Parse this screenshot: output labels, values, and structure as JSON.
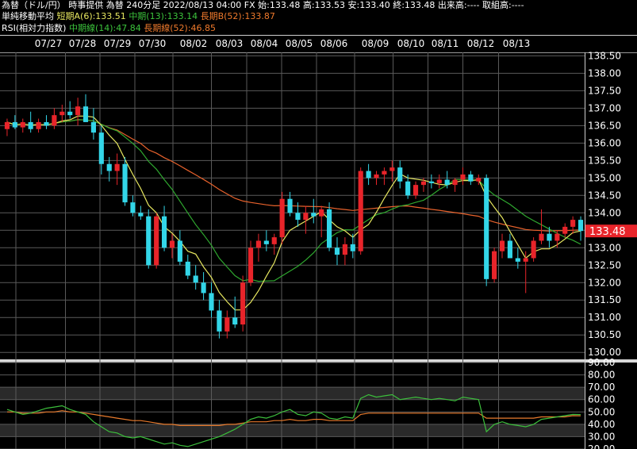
{
  "header": {
    "line1": "為替（ドル/円） 時事提供 為替 240分足 2022/08/13 04:00 FX 始:133.48 高:133.53 安:133.40 終:133.48 出来高:---- 取組高:----",
    "line2_prefix": "単純移動平均 ",
    "ma_short": "短期A(6):133.51",
    "ma_mid": "中期(13):133.14",
    "ma_long": "長期B(52):133.87",
    "line3_prefix": "RSI(相対力指数) ",
    "rsi_mid": "中期線(14):47.84",
    "rsi_long": "長期線(52):46.85"
  },
  "colors": {
    "up": "#e8242a",
    "down": "#33d6e8",
    "ma_short": "#e8e860",
    "ma_mid": "#2fa82f",
    "ma_long": "#e8622c",
    "rsi_mid": "#3cbf3c",
    "rsi_long": "#e87a2c",
    "price_tag": "#e8242a"
  },
  "chart_data": [
    {
      "type": "candlestick",
      "x_labels": [
        "07/27",
        "07/28",
        "07/29",
        "07/30",
        "08/02",
        "08/03",
        "08/04",
        "08/05",
        "08/06",
        "08/09",
        "08/10",
        "08/11",
        "08/12",
        "08/13"
      ],
      "y_ticks": [
        "138.50",
        "138.00",
        "137.50",
        "137.00",
        "136.50",
        "136.00",
        "135.50",
        "135.00",
        "134.50",
        "134.00",
        "133.50",
        "133.00",
        "132.50",
        "132.00",
        "131.50",
        "131.00",
        "130.50",
        "130.00"
      ],
      "ylim": [
        129.8,
        138.6
      ],
      "last_price": "133.48",
      "candles": [
        [
          136.4,
          136.7,
          136.2,
          136.6
        ],
        [
          136.6,
          136.8,
          136.4,
          136.45
        ],
        [
          136.45,
          136.7,
          136.3,
          136.6
        ],
        [
          136.6,
          136.9,
          136.3,
          136.4
        ],
        [
          136.4,
          136.7,
          136.3,
          136.6
        ],
        [
          136.6,
          136.8,
          136.4,
          136.5
        ],
        [
          136.5,
          137.0,
          136.4,
          136.8
        ],
        [
          136.8,
          137.1,
          136.6,
          136.9
        ],
        [
          136.9,
          137.2,
          136.7,
          136.8
        ],
        [
          136.8,
          137.3,
          136.5,
          137.05
        ],
        [
          137.05,
          137.4,
          136.7,
          136.6
        ],
        [
          136.6,
          137.0,
          136.1,
          136.3
        ],
        [
          136.3,
          136.5,
          135.1,
          135.4
        ],
        [
          135.4,
          135.6,
          134.9,
          135.2
        ],
        [
          135.2,
          135.7,
          134.8,
          135.4
        ],
        [
          135.4,
          135.6,
          134.2,
          134.3
        ],
        [
          134.3,
          134.5,
          133.9,
          134.0
        ],
        [
          134.0,
          134.2,
          133.8,
          133.9
        ],
        [
          133.9,
          134.1,
          132.4,
          132.5
        ],
        [
          132.5,
          134.0,
          132.4,
          133.9
        ],
        [
          133.9,
          134.2,
          132.9,
          133.0
        ],
        [
          133.0,
          133.4,
          132.7,
          133.2
        ],
        [
          133.2,
          133.5,
          132.5,
          132.6
        ],
        [
          132.6,
          132.8,
          132.1,
          132.2
        ],
        [
          132.2,
          132.5,
          131.8,
          132.0
        ],
        [
          132.0,
          132.3,
          131.5,
          131.7
        ],
        [
          131.7,
          132.0,
          131.0,
          131.2
        ],
        [
          131.2,
          131.5,
          130.4,
          130.6
        ],
        [
          130.6,
          131.2,
          130.4,
          131.0
        ],
        [
          131.0,
          131.6,
          130.7,
          130.8
        ],
        [
          130.8,
          132.2,
          130.6,
          132.0
        ],
        [
          132.0,
          133.2,
          131.9,
          133.0
        ],
        [
          133.0,
          133.4,
          132.6,
          133.2
        ],
        [
          133.2,
          133.5,
          132.9,
          133.1
        ],
        [
          133.1,
          133.4,
          132.8,
          133.3
        ],
        [
          133.3,
          134.6,
          133.1,
          134.4
        ],
        [
          134.4,
          134.6,
          133.9,
          134.0
        ],
        [
          134.0,
          134.3,
          133.6,
          133.8
        ],
        [
          133.8,
          134.2,
          133.4,
          134.0
        ],
        [
          134.0,
          134.4,
          133.7,
          133.9
        ],
        [
          133.9,
          134.2,
          133.3,
          134.1
        ],
        [
          134.1,
          134.3,
          132.9,
          133.0
        ],
        [
          133.0,
          133.3,
          132.5,
          132.8
        ],
        [
          132.8,
          133.3,
          132.5,
          133.1
        ],
        [
          133.1,
          133.4,
          132.7,
          132.9
        ],
        [
          132.9,
          135.3,
          132.8,
          135.2
        ],
        [
          135.2,
          135.4,
          134.8,
          135.0
        ],
        [
          135.0,
          135.2,
          134.8,
          135.1
        ],
        [
          135.1,
          135.3,
          134.8,
          135.2
        ],
        [
          135.2,
          135.5,
          134.9,
          135.3
        ],
        [
          135.3,
          135.5,
          134.7,
          134.9
        ],
        [
          134.9,
          135.1,
          134.4,
          134.5
        ],
        [
          134.5,
          134.9,
          134.4,
          134.8
        ],
        [
          134.8,
          135.0,
          134.6,
          134.9
        ],
        [
          134.9,
          135.1,
          134.7,
          134.85
        ],
        [
          134.85,
          135.1,
          134.7,
          134.95
        ],
        [
          134.95,
          135.2,
          134.7,
          134.8
        ],
        [
          134.8,
          135.0,
          134.6,
          134.95
        ],
        [
          134.95,
          135.3,
          134.8,
          135.1
        ],
        [
          135.1,
          135.2,
          134.8,
          134.9
        ],
        [
          134.9,
          135.1,
          134.8,
          135.0
        ],
        [
          135.0,
          135.1,
          131.9,
          132.1
        ],
        [
          132.1,
          133.0,
          132.0,
          132.9
        ],
        [
          132.9,
          133.4,
          132.7,
          133.2
        ],
        [
          133.2,
          133.4,
          132.8,
          132.7
        ],
        [
          132.7,
          133.0,
          132.4,
          132.6
        ],
        [
          132.6,
          132.9,
          131.7,
          132.7
        ],
        [
          132.7,
          133.3,
          132.6,
          133.2
        ],
        [
          133.2,
          134.1,
          133.1,
          133.4
        ],
        [
          133.4,
          133.6,
          133.0,
          133.2
        ],
        [
          133.2,
          133.5,
          133.0,
          133.4
        ],
        [
          133.4,
          133.7,
          133.3,
          133.6
        ],
        [
          133.6,
          133.9,
          133.4,
          133.8
        ],
        [
          133.8,
          133.9,
          133.2,
          133.48
        ]
      ]
    },
    {
      "type": "line",
      "title": "RSI(相対力指数)",
      "y_ticks": [
        "90.00",
        "80.00",
        "70.00",
        "60.00",
        "50.00",
        "40.00",
        "30.00",
        "20.00"
      ],
      "ylim": [
        20,
        90
      ],
      "series": [
        {
          "name": "中期線(14)",
          "values": [
            52,
            50,
            48,
            49,
            51,
            53,
            54,
            55,
            52,
            50,
            48,
            42,
            38,
            34,
            33,
            30,
            29,
            30,
            28,
            26,
            24,
            25,
            23,
            22,
            24,
            26,
            28,
            30,
            33,
            36,
            40,
            44,
            46,
            45,
            47,
            50,
            52,
            48,
            47,
            50,
            49,
            45,
            44,
            46,
            45,
            61,
            64,
            62,
            63,
            64,
            60,
            61,
            62,
            61,
            60,
            61,
            60,
            59,
            62,
            61,
            60,
            34,
            40,
            42,
            40,
            39,
            38,
            40,
            44,
            45,
            46,
            47,
            48,
            47.84
          ]
        },
        {
          "name": "長期線(52)",
          "values": [
            50,
            50,
            49,
            49,
            49,
            50,
            50,
            51,
            50,
            50,
            49,
            48,
            47,
            46,
            45,
            44,
            43,
            43,
            42,
            41,
            40,
            40,
            39,
            39,
            39,
            39,
            39,
            39,
            40,
            40,
            41,
            42,
            42,
            42,
            43,
            43,
            44,
            43,
            43,
            44,
            44,
            43,
            43,
            43,
            43,
            48,
            49,
            49,
            49,
            49,
            49,
            49,
            49,
            49,
            49,
            49,
            49,
            49,
            49,
            49,
            49,
            45,
            45,
            45,
            45,
            45,
            45,
            45,
            46,
            46,
            46,
            46,
            47,
            46.85
          ]
        }
      ]
    }
  ]
}
